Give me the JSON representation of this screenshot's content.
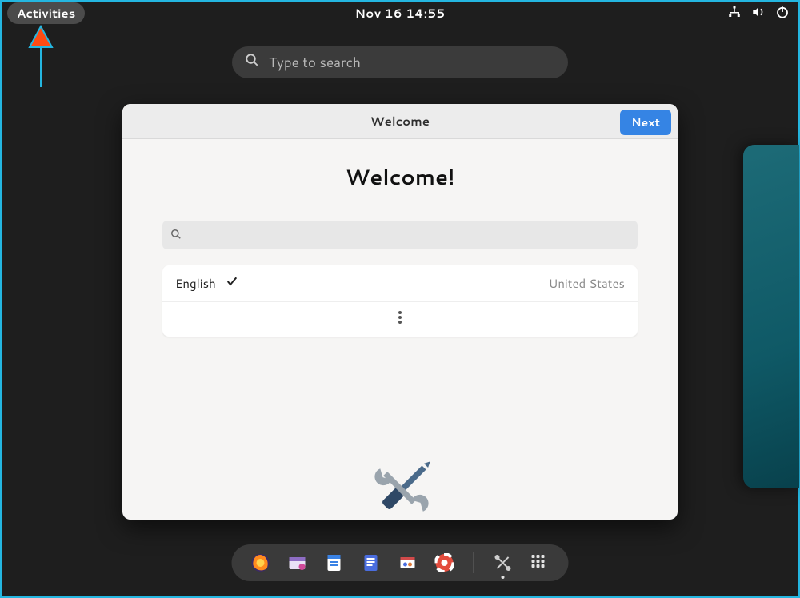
{
  "topbar": {
    "activities": "Activities",
    "clock": "Nov 16  14:55"
  },
  "search": {
    "placeholder": "Type to search"
  },
  "welcome": {
    "header_title": "Welcome",
    "next_label": "Next",
    "heading": "Welcome!",
    "languages": [
      {
        "name": "English",
        "region": "United States",
        "selected": true
      }
    ]
  },
  "dock": {
    "items": [
      {
        "name": "firefox"
      },
      {
        "name": "files"
      },
      {
        "name": "text-editor"
      },
      {
        "name": "documents"
      },
      {
        "name": "software"
      },
      {
        "name": "help"
      },
      {
        "name": "settings"
      }
    ],
    "running": "settings"
  }
}
